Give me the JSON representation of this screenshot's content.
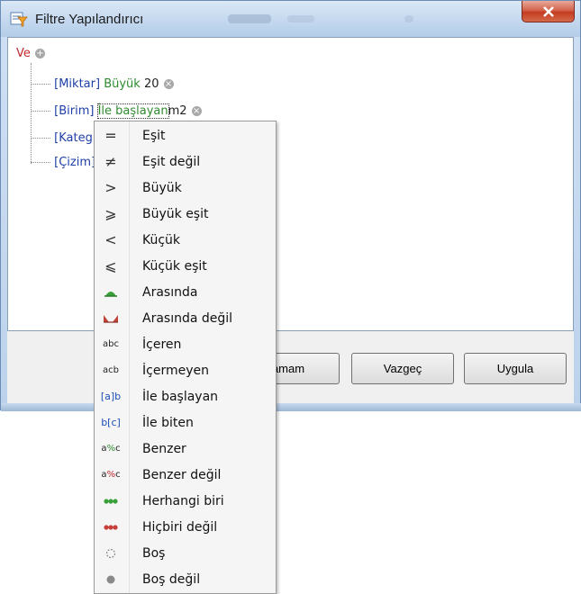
{
  "window": {
    "title": "Filtre Yapılandırıcı"
  },
  "tree": {
    "root_operator": "Ve",
    "rows": [
      {
        "field": "[Miktar]",
        "operator": "Büyük",
        "value": "20"
      },
      {
        "field": "[Birim]",
        "operator": "İle başlayan",
        "value": "m2"
      },
      {
        "field": "[Kateg",
        "operator": "",
        "value": ""
      },
      {
        "field": "[Çizim]",
        "operator": "",
        "value": ""
      }
    ]
  },
  "buttons": {
    "ok": "amam",
    "cancel": "Vazgeç",
    "apply": "Uygula"
  },
  "menu": {
    "items": [
      {
        "icon": "=",
        "label": "Eşit"
      },
      {
        "icon": "≠",
        "label": "Eşit değil"
      },
      {
        "icon": ">",
        "label": "Büyük"
      },
      {
        "icon": "⩾",
        "label": "Büyük eşit"
      },
      {
        "icon": "<",
        "label": "Küçük"
      },
      {
        "icon": "⩽",
        "label": "Küçük eşit"
      },
      {
        "icon": "between",
        "label": "Arasında"
      },
      {
        "icon": "not-between",
        "label": "Arasında değil"
      },
      {
        "icon": "abc",
        "label": "İçeren"
      },
      {
        "icon": "acb",
        "label": "İçermeyen"
      },
      {
        "icon": "[a]b",
        "label": "İle başlayan"
      },
      {
        "icon": "b[c]",
        "label": "İle biten"
      },
      {
        "icon": "a%c",
        "label": "Benzer"
      },
      {
        "icon": "a%c",
        "label": "Benzer değil"
      },
      {
        "icon": "any-of",
        "label": "Herhangi biri"
      },
      {
        "icon": "none-of",
        "label": "Hiçbiri değil"
      },
      {
        "icon": "empty",
        "label": "Boş"
      },
      {
        "icon": "not-empty",
        "label": "Boş değil"
      }
    ]
  },
  "colors": {
    "field": "#1f3fa8",
    "operator": "#2e8b2e",
    "root_operator": "#c0282d"
  }
}
